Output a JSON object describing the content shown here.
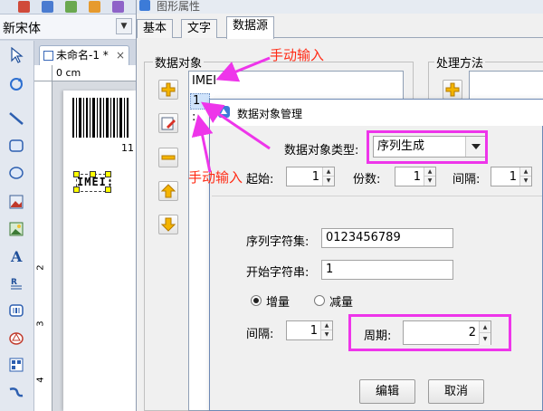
{
  "editor": {
    "font_name": "新宋体",
    "document_tab": "未命名-1 *",
    "ruler_unit": "0 cm",
    "barcode_digits": "11",
    "imei_text": "IMEI:"
  },
  "props_dialog": {
    "title": "图形属性",
    "tabs": [
      "基本",
      "文字",
      "数据源"
    ],
    "active_tab": "数据源",
    "data_objects_group": "数据对象",
    "processing_group": "处理方法",
    "data_objects": [
      "IMEI",
      "1",
      ":"
    ]
  },
  "manager_dialog": {
    "title": "数据对象管理",
    "type_label": "数据对象类型:",
    "type_value": "序列生成",
    "start_label": "起始:",
    "start_value": "1",
    "copies_label": "份数:",
    "copies_value": "1",
    "interval_label": "间隔:",
    "interval_value": "1",
    "charset_label": "序列字符集:",
    "charset_value": "0123456789",
    "start_string_label": "开始字符串:",
    "start_string_value": "1",
    "increment_label": "增量",
    "decrement_label": "减量",
    "step_label": "间隔:",
    "step_value": "1",
    "period_label": "周期:",
    "period_value": "2",
    "edit_button": "编辑",
    "cancel_button": "取消"
  },
  "annotations": {
    "top": "手动输入",
    "bottom": "手动输入"
  },
  "colors": {
    "annotation_text": "#ff2a14",
    "highlight": "#ee35ea"
  }
}
